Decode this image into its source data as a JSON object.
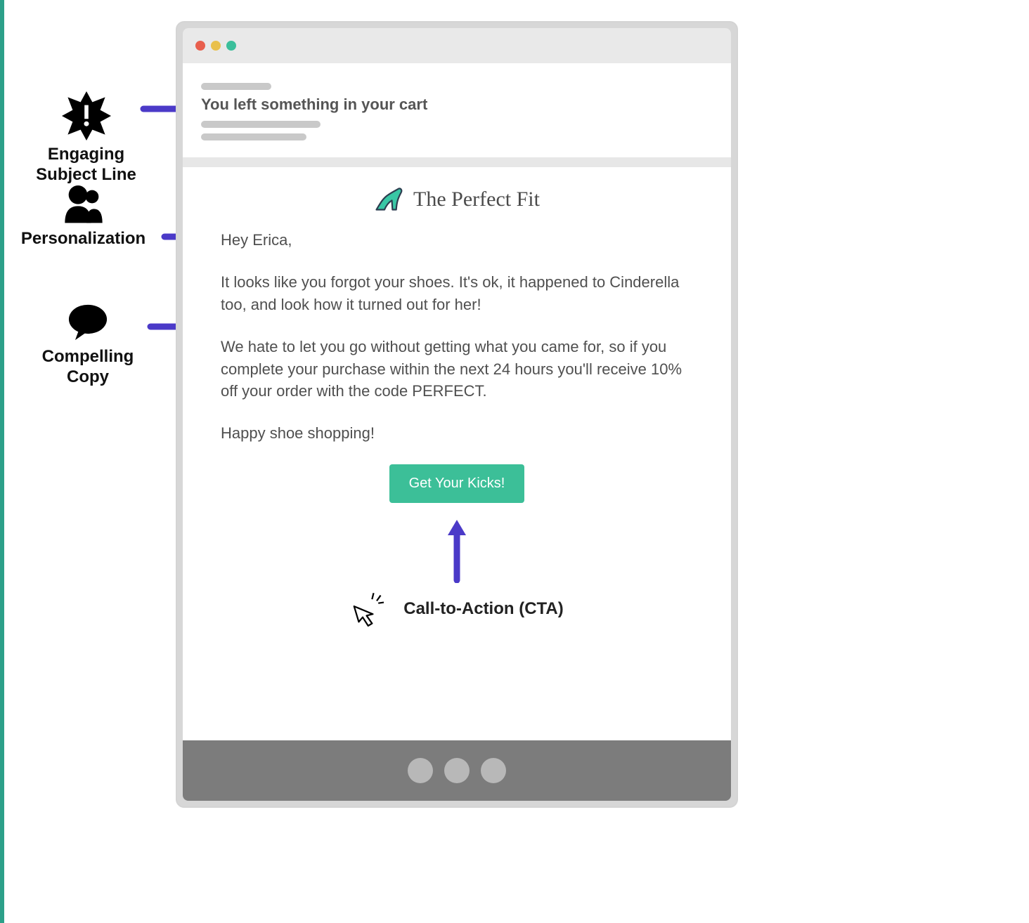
{
  "annotations": {
    "subject": "Engaging\nSubject Line",
    "personalization": "Personalization",
    "copy": "Compelling\nCopy",
    "cta": "Call-to-Action (CTA)"
  },
  "email": {
    "subject_line": "You left something in your cart",
    "brand": "The Perfect Fit",
    "greeting": "Hey Erica,",
    "p1": "It looks like you forgot your shoes. It's ok, it happened to Cinderella too, and look how it turned out for her!",
    "p2": "We hate to let you go without getting what you came for, so if you complete your purchase within the next 24 hours you'll receive 10% off your order with the code PERFECT.",
    "p3": "Happy shoe shopping!",
    "cta_label": "Get Your Kicks!"
  },
  "colors": {
    "accent_teal": "#3CBF98",
    "arrow_purple": "#4B3AC8"
  }
}
